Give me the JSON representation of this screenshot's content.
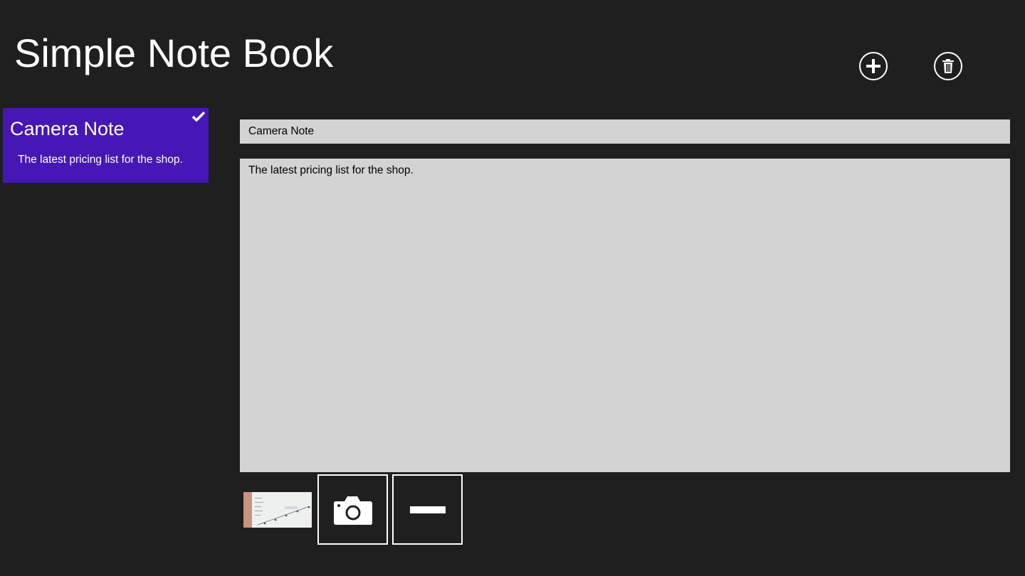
{
  "app": {
    "title": "Simple Note Book"
  },
  "toolbar": {
    "add_icon": "add-circle-icon",
    "delete_icon": "trash-circle-icon"
  },
  "notes_list": [
    {
      "title": "Camera Note",
      "preview": "The latest pricing list for the shop.",
      "selected": true
    }
  ],
  "editor": {
    "title_value": "Camera Note",
    "body_value": "The latest pricing list for the shop."
  },
  "attachments": {
    "thumbnail_icon": "photo-thumbnail",
    "camera_icon": "camera-icon",
    "remove_icon": "minus-icon"
  },
  "colors": {
    "background": "#1f1f1f",
    "accent": "#4617b4",
    "input_bg": "#d3d3d3"
  }
}
